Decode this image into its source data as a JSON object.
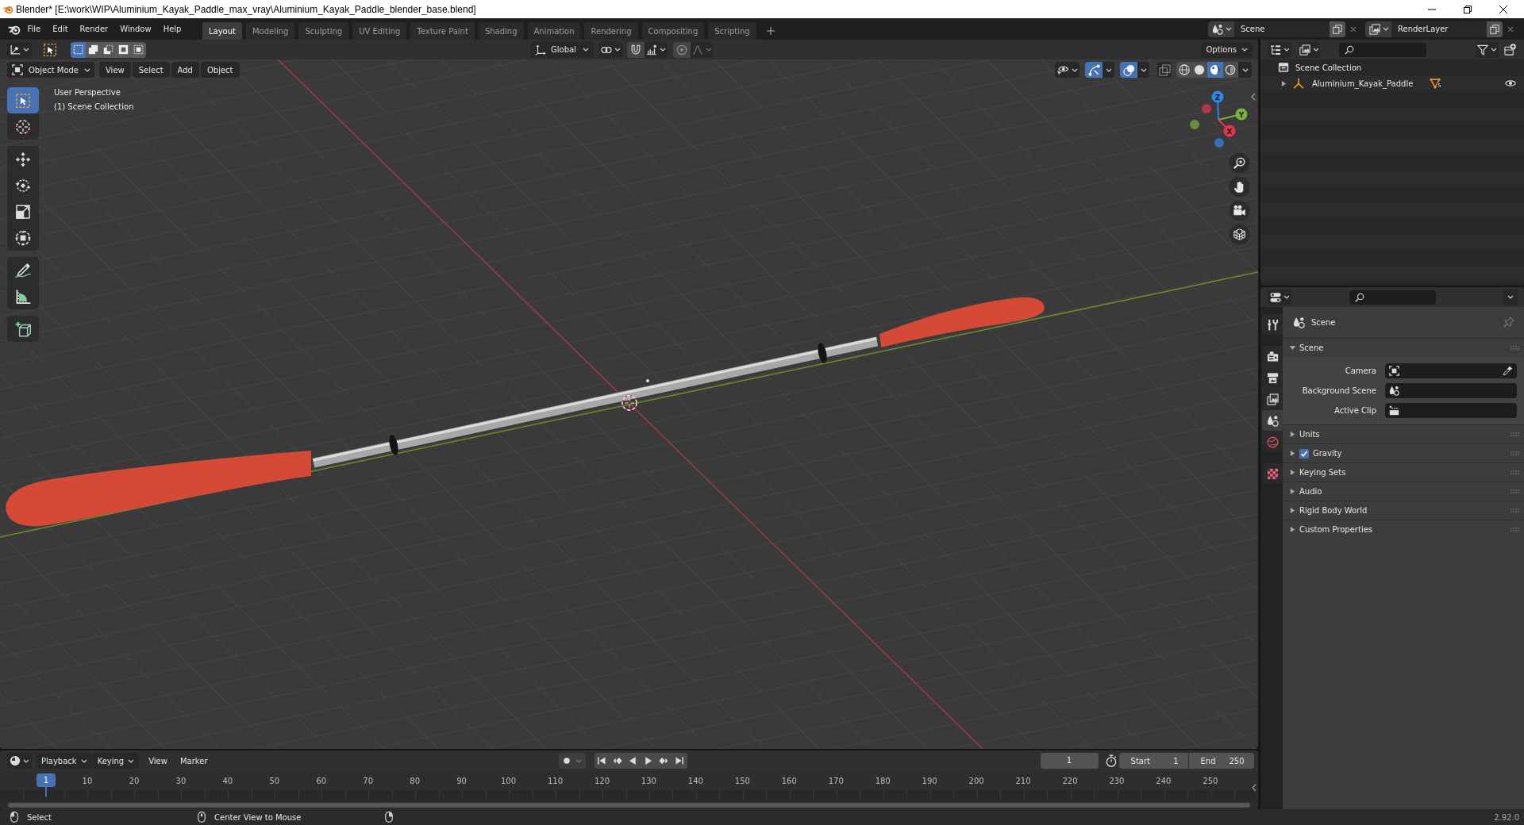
{
  "window": {
    "title": "Blender* [E:\\work\\WIP\\Aluminium_Kayak_Paddle_max_vray\\Aluminium_Kayak_Paddle_blender_base.blend]"
  },
  "menu": [
    "File",
    "Edit",
    "Render",
    "Window",
    "Help"
  ],
  "workspaces": [
    {
      "label": "Layout",
      "selected": true
    },
    {
      "label": "Modeling",
      "selected": false
    },
    {
      "label": "Sculpting",
      "selected": false
    },
    {
      "label": "UV Editing",
      "selected": false
    },
    {
      "label": "Texture Paint",
      "selected": false
    },
    {
      "label": "Shading",
      "selected": false
    },
    {
      "label": "Animation",
      "selected": false
    },
    {
      "label": "Rendering",
      "selected": false
    },
    {
      "label": "Compositing",
      "selected": false
    },
    {
      "label": "Scripting",
      "selected": false
    }
  ],
  "scene": {
    "value": "Scene"
  },
  "view_layer": {
    "value": "RenderLayer"
  },
  "tool_settings": {
    "selection_modes": [
      {
        "kind": "set",
        "selected": true
      },
      {
        "kind": "extend",
        "selected": false
      },
      {
        "kind": "subtract",
        "selected": false
      },
      {
        "kind": "invert",
        "selected": false
      },
      {
        "kind": "intersect",
        "selected": false
      }
    ],
    "orientation": "Global",
    "options": "Options"
  },
  "viewport": {
    "mode": "Object Mode",
    "menus": [
      "View",
      "Select",
      "Add",
      "Object"
    ],
    "toggles": [
      {
        "kind": "gizmos",
        "on": true
      },
      {
        "kind": "overlays",
        "on": true
      },
      {
        "kind": "xray",
        "on": false
      }
    ],
    "shading": [
      {
        "kind": "wireframe",
        "selected": false
      },
      {
        "kind": "solid",
        "selected": false
      },
      {
        "kind": "material",
        "selected": true
      },
      {
        "kind": "rendered",
        "selected": false
      }
    ],
    "info": [
      "User Perspective",
      "(1) Scene Collection"
    ],
    "tool_groups": [
      {
        "tools": [
          {
            "kind": "select",
            "selected": true
          },
          {
            "kind": "cursor",
            "selected": false
          }
        ]
      },
      {
        "tools": [
          {
            "kind": "move",
            "selected": false
          },
          {
            "kind": "rotate",
            "selected": false
          },
          {
            "kind": "scale",
            "selected": false
          },
          {
            "kind": "transform",
            "selected": false
          }
        ]
      },
      {
        "tools": [
          {
            "kind": "annotate",
            "selected": false
          },
          {
            "kind": "measure",
            "selected": false
          }
        ]
      },
      {
        "tools": [
          {
            "kind": "add_cube",
            "selected": false
          }
        ]
      }
    ],
    "axes": [
      {
        "label": "Z",
        "color": "#2e87e8"
      },
      {
        "label": "Y",
        "color": "#7ab239"
      },
      {
        "label": "X",
        "color": "#e8344f"
      }
    ]
  },
  "outliner": {
    "root": "Scene Collection",
    "items": [
      {
        "name": "Aluminium_Kayak_Paddle",
        "expanded": false,
        "data_count": "5",
        "visible": true
      }
    ]
  },
  "properties": {
    "tab_groups": [
      {
        "tabs": [
          {
            "kind": "tool",
            "selected": false
          }
        ]
      },
      {
        "tabs": [
          {
            "kind": "render",
            "selected": false
          },
          {
            "kind": "output",
            "selected": false
          },
          {
            "kind": "view_layer",
            "selected": false
          },
          {
            "kind": "scene",
            "selected": true
          },
          {
            "kind": "world",
            "selected": false
          }
        ]
      },
      {
        "tabs": [
          {
            "kind": "texture",
            "selected": false
          }
        ]
      }
    ],
    "context": "Scene",
    "panels": [
      {
        "title": "Scene",
        "expanded": true,
        "fields": [
          {
            "label": "Camera",
            "kind": "camera"
          },
          {
            "label": "Background Scene",
            "kind": "scene"
          },
          {
            "label": "Active Clip",
            "kind": "clip"
          }
        ]
      },
      {
        "title": "Units",
        "expanded": false
      },
      {
        "title": "Gravity",
        "expanded": false,
        "checkbox": {
          "checked": true
        }
      },
      {
        "title": "Keying Sets",
        "expanded": false
      },
      {
        "title": "Audio",
        "expanded": false
      },
      {
        "title": "Rigid Body World",
        "expanded": false
      },
      {
        "title": "Custom Properties",
        "expanded": false
      }
    ]
  },
  "timeline": {
    "menus": [
      {
        "label": "Playback",
        "kind": "dropdown"
      },
      {
        "label": "Keying",
        "kind": "dropdown"
      },
      {
        "label": "View",
        "kind": "menu"
      },
      {
        "label": "Marker",
        "kind": "menu"
      }
    ],
    "current_frame": "1",
    "start": {
      "label": "Start",
      "value": "1"
    },
    "end": {
      "label": "End",
      "value": "250"
    },
    "playhead": "1",
    "ticks": [
      "10",
      "20",
      "30",
      "40",
      "50",
      "60",
      "70",
      "80",
      "90",
      "100",
      "110",
      "120",
      "130",
      "140",
      "150",
      "160",
      "170",
      "180",
      "190",
      "200",
      "210",
      "220",
      "230",
      "240",
      "250"
    ]
  },
  "status_bar": {
    "hints": [
      {
        "kind": "left",
        "text": "Select"
      },
      {
        "kind": "middle",
        "text": "Center View to Mouse"
      },
      {
        "kind": "right"
      }
    ],
    "version": "2.92.0"
  }
}
